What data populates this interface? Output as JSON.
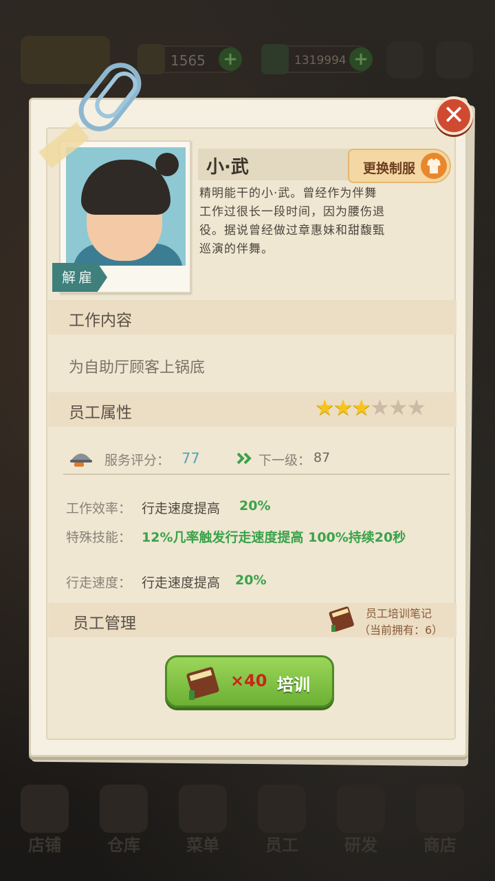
{
  "top_bar": {
    "currency1": "1565",
    "currency2": "1319994",
    "plus": "+"
  },
  "bottom_nav": [
    {
      "label": "店铺"
    },
    {
      "label": "仓库"
    },
    {
      "label": "菜单"
    },
    {
      "label": "员工"
    },
    {
      "label": "研发"
    },
    {
      "label": "商店"
    }
  ],
  "close": "✕",
  "employee": {
    "name": "小·武",
    "dismiss": "解雇",
    "uniform_button": "更换制服",
    "description": "精明能干的小·武。曾经作为伴舞工作过很长一段时间，因为腰伤退役。据说曾经做过章惠妹和甜馥甄巡演的伴舞。"
  },
  "job": {
    "title": "工作内容",
    "content": "为自助厅顾客上锅底"
  },
  "attributes": {
    "title": "员工属性",
    "stars": {
      "filled": 3,
      "total": 6
    },
    "service_label": "服务评分：",
    "service_value": "77",
    "next_label": "下一级：",
    "next_value": "87",
    "efficiency_label": "工作效率：",
    "efficiency_text": "行走速度提高",
    "efficiency_value": "20%",
    "skill_label": "特殊技能：",
    "skill_text": "12%几率触发行走速度提高 100%持续20秒",
    "speed_label": "行走速度：",
    "speed_text": "行走速度提高",
    "speed_value": "20%"
  },
  "management": {
    "title": "员工管理",
    "notes_title": "员工培训笔记",
    "notes_owned": "（当前拥有：6）",
    "train_cost": "×40",
    "train_label": "培训"
  },
  "colors": {
    "accent_green": "#3aa24a",
    "accent_blue": "#4fa6b5",
    "close_red": "#d04a32"
  }
}
